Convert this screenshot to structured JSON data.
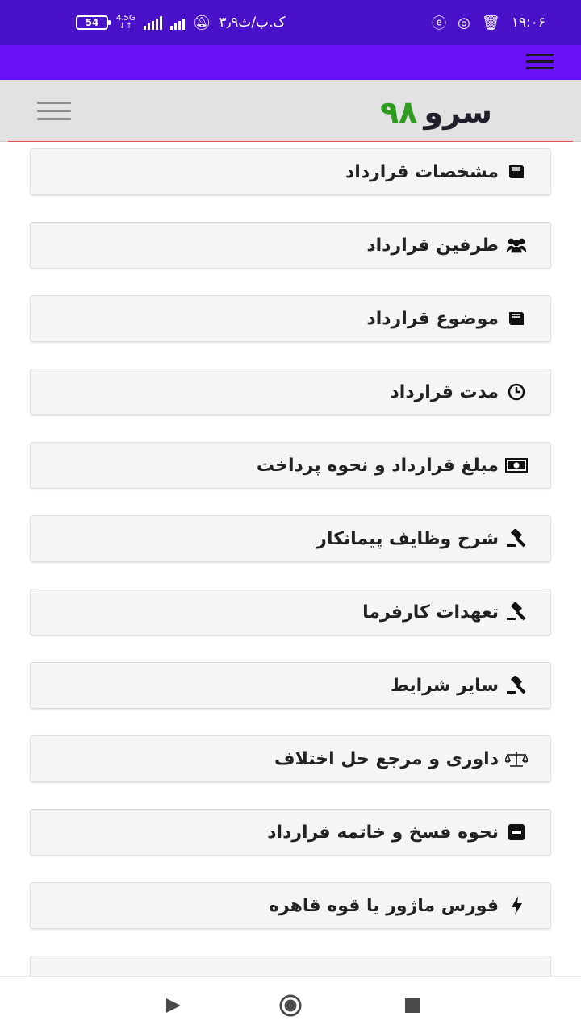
{
  "status_bar": {
    "time": "۱۹:۰۶",
    "speed": "۳٫۹ک.ب/ث",
    "battery": "54",
    "network": "4.5G",
    "icons": [
      "clock-icon",
      "instagram-icon",
      "trash-icon",
      "e-app-icon",
      "bell-muted-icon",
      "signal-icon"
    ]
  },
  "app_bar": {
    "brand_word": "سرو",
    "brand_number": "۹۸",
    "brand_number_color": "#2e9c1e",
    "accent_color": "#6a10f5",
    "status_color": "#4a12c8"
  },
  "menu": {
    "items": [
      {
        "label": "مشخصات قرارداد",
        "icon": "book-icon"
      },
      {
        "label": "طرفین قرارداد",
        "icon": "users-icon"
      },
      {
        "label": "موضوع قرارداد",
        "icon": "book-icon"
      },
      {
        "label": "مدت قرارداد",
        "icon": "clock-icon"
      },
      {
        "label": "مبلغ قرارداد و نحوه پرداخت",
        "icon": "money-icon"
      },
      {
        "label": "شرح وظایف پیمانکار",
        "icon": "gavel-icon"
      },
      {
        "label": "تعهدات کارفرما",
        "icon": "gavel-icon"
      },
      {
        "label": "سایر شرایط",
        "icon": "gavel-icon"
      },
      {
        "label": "داوری و مرجع حل اختلاف",
        "icon": "scale-icon"
      },
      {
        "label": "نحوه فسخ و خاتمه قرارداد",
        "icon": "minus-square-icon"
      },
      {
        "label": "فورس ماژور یا قوه قاهره",
        "icon": "bolt-icon"
      }
    ]
  },
  "bottom_nav": {
    "icons": [
      "back-icon",
      "home-icon",
      "recent-apps-icon"
    ]
  }
}
